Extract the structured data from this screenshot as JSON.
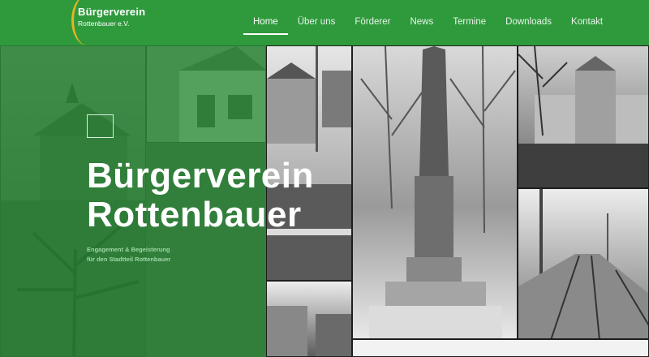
{
  "header": {
    "logo_name": "Bürgerverein",
    "logo_sub": "Rottenbauer e.V.",
    "nav": [
      {
        "label": "Home",
        "active": true
      },
      {
        "label": "Über uns"
      },
      {
        "label": "Förderer"
      },
      {
        "label": "News"
      },
      {
        "label": "Termine"
      },
      {
        "label": "Downloads"
      },
      {
        "label": "Kontakt"
      }
    ]
  },
  "hero": {
    "title_line1": "Bürgerverein",
    "title_line2": "Rottenbauer",
    "subtitle_line1": "Engagement & Begeisterung",
    "subtitle_line2": "für den Stadtteil Rottenbauer"
  },
  "colors": {
    "brand_green": "#2e9a3c",
    "logo_accent": "#e6b422"
  }
}
